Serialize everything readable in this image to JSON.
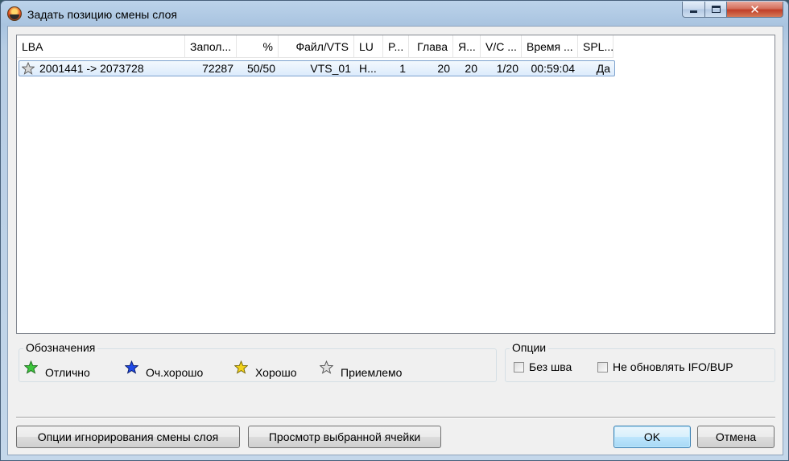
{
  "window": {
    "title": "Задать позицию смены слоя"
  },
  "listview": {
    "columns": [
      "LBA",
      "Запол...",
      "%",
      "Файл/VTS",
      "LU",
      "P...",
      "Глава",
      "Я...",
      "V/C ...",
      "Время ...",
      "SPL..."
    ],
    "rows": [
      {
        "icon": "gray-star-icon",
        "cells": [
          "2001441 -> 2073728",
          "72287",
          "50/50",
          "VTS_01",
          "Н...",
          "1",
          "20",
          "20",
          "1/20",
          "00:59:04",
          "Да"
        ]
      }
    ]
  },
  "legend": {
    "title": "Обозначения",
    "items": [
      {
        "label": "Отлично",
        "icon": "green-star-icon",
        "color": "#3cc63c"
      },
      {
        "label": "Оч.хорошо",
        "icon": "blue-star-icon",
        "color": "#1f49e8"
      },
      {
        "label": "Хорошо",
        "icon": "yellow-star-icon",
        "color": "#f2d21a"
      },
      {
        "label": "Приемлемо",
        "icon": "gray-star-icon",
        "color": "#cfcfcf"
      }
    ]
  },
  "options": {
    "title": "Опции",
    "items": [
      {
        "label": "Без шва",
        "checked": false
      },
      {
        "label": "Не обновлять IFO/BUP",
        "checked": false
      }
    ]
  },
  "buttons": {
    "ignore_options": "Опции игнорирования смены слоя",
    "view_cell": "Просмотр выбранной ячейки",
    "ok": "OK",
    "cancel": "Отмена"
  },
  "colors": {
    "selection_border": "#7da2ce",
    "default_button_border": "#3c7fb1"
  }
}
